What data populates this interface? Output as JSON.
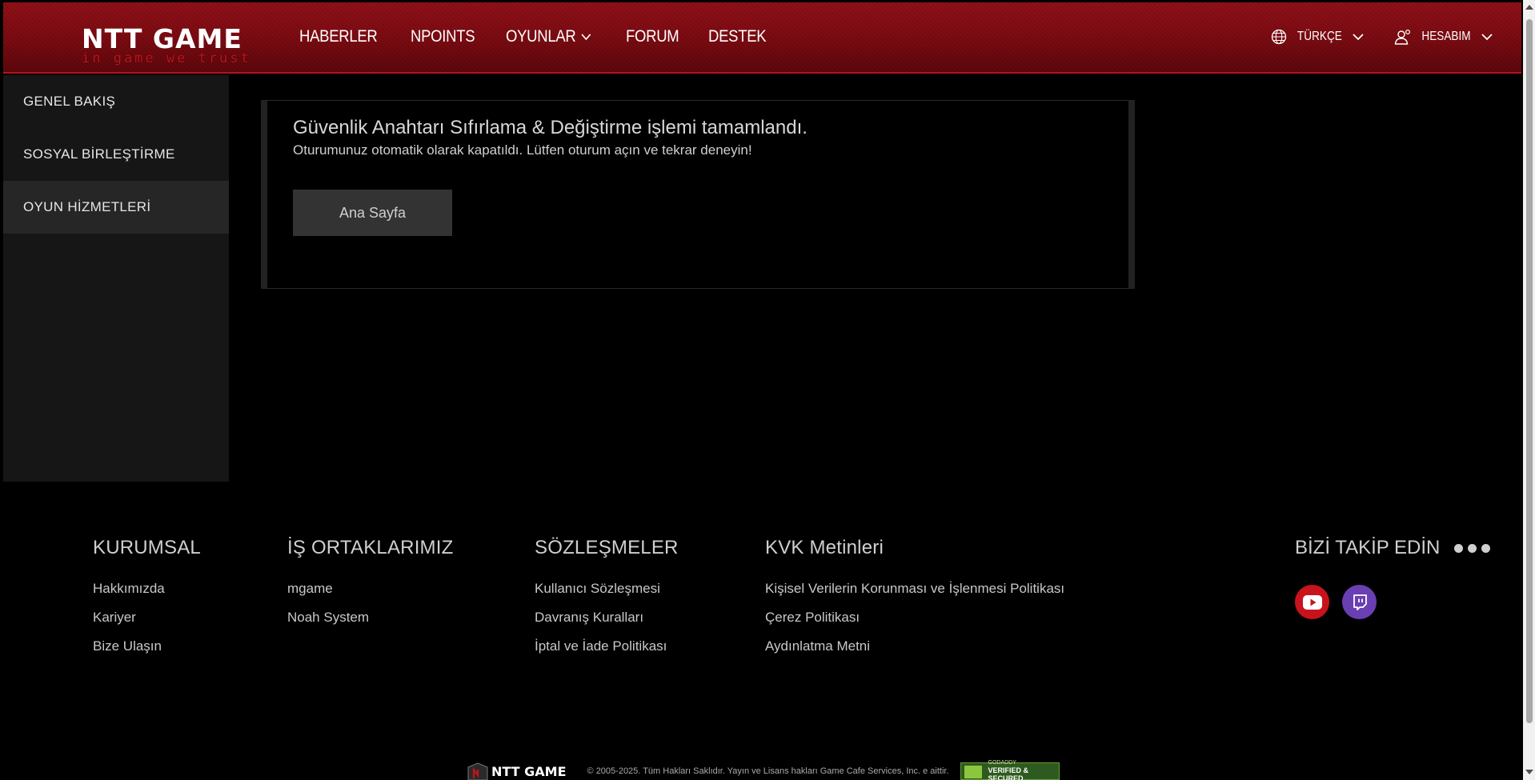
{
  "header": {
    "logo_main": "NTT GAME",
    "logo_tagline": "in game we trust",
    "nav": [
      {
        "label": "HABERLER"
      },
      {
        "label": "NPOINTS"
      },
      {
        "label": "OYUNLAR"
      },
      {
        "label": "FORUM"
      },
      {
        "label": "DESTEK"
      }
    ],
    "language_label": "TÜRKÇE",
    "account_label": "HESABIM",
    "icons": {
      "language": "globe-icon",
      "account": "user-icon"
    }
  },
  "sidebar": {
    "items": [
      {
        "label": "GENEL BAKIŞ"
      },
      {
        "label": "SOSYAL BİRLEŞTİRME"
      },
      {
        "label": "OYUN HİZMETLERİ"
      }
    ],
    "active_index": 2
  },
  "panel": {
    "title": "Güvenlik Anahtarı Sıfırlama & Değiştirme işlemi tamamlandı.",
    "subtitle": "Oturumunuz otomatik olarak kapatıldı. Lütfen oturum açın ve tekrar deneyin!",
    "button_label": "Ana Sayfa"
  },
  "footer": {
    "columns": [
      {
        "title": "KURUMSAL",
        "links": [
          "Hakkımızda",
          "Kariyer",
          "Bize Ulaşın"
        ]
      },
      {
        "title": "İŞ ORTAKLARIMIZ",
        "links": [
          "mgame",
          "Noah System"
        ]
      },
      {
        "title": "SÖZLEŞMELER",
        "links": [
          "Kullanıcı Sözleşmesi",
          "Davranış Kuralları",
          "İptal ve İade Politikası"
        ]
      },
      {
        "title": "KVK Metinleri",
        "links": [
          "Kişisel Verilerin Korunması ve İşlenmesi Politikası",
          "Çerez Politikası",
          "Aydınlatma Metni"
        ]
      }
    ],
    "follow_title": "BİZİ TAKİP EDİN",
    "social": [
      "youtube-icon",
      "twitch-icon"
    ],
    "bottom_logo": "NTT GAME",
    "copyright": "© 2005-2025. Tüm Hakları Saklıdır. Yayın ve Lisans hakları Game Cafe Services, Inc. e aittir.",
    "badge_line1": "GODADDY",
    "badge_line2": "VERIFIED & SECURED"
  },
  "colors": {
    "header_red": "#8a0d14",
    "accent_red": "#c3141c",
    "sidebar_bg": "#161616",
    "sidebar_active": "#262626",
    "button_bg": "#333333",
    "youtube": "#c8131c",
    "twitch": "#6a3fb3"
  }
}
